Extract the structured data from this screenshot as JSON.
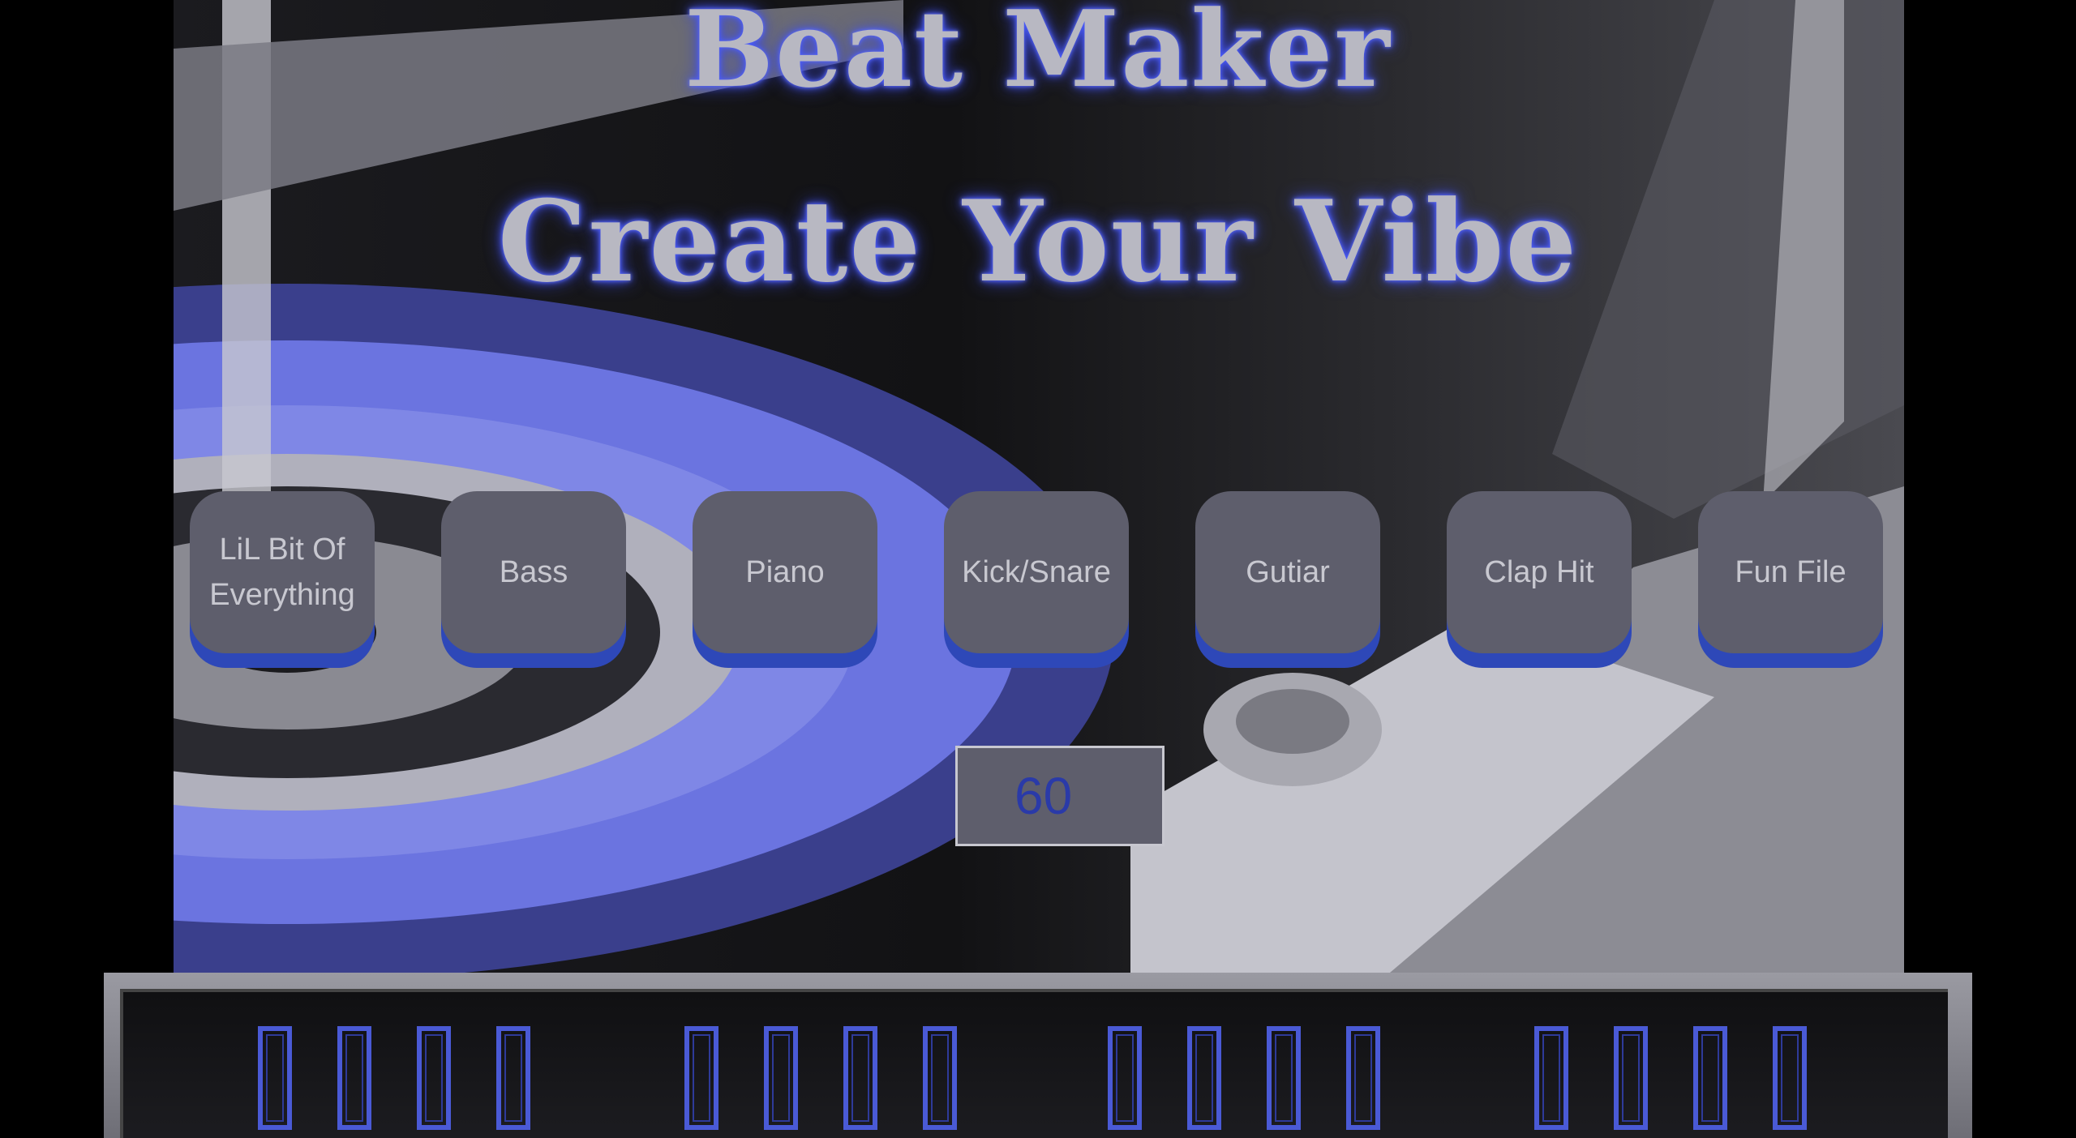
{
  "header": {
    "title_line_1": "Beat Maker",
    "title_line_2": "Create Your Vibe"
  },
  "instruments": [
    {
      "label": "LiL Bit Of Everything"
    },
    {
      "label": "Bass"
    },
    {
      "label": "Piano"
    },
    {
      "label": "Kick/Snare"
    },
    {
      "label": "Gutiar"
    },
    {
      "label": "Clap Hit"
    },
    {
      "label": "Fun File"
    }
  ],
  "tempo": {
    "value": "60"
  },
  "sequencer": {
    "groups": 4,
    "steps_per_group": 4
  },
  "colors": {
    "accent": "#2e48b8",
    "button_face": "#5e5e6c",
    "title_glow": "#4a5cff",
    "step_outline": "#4a5ad6"
  }
}
